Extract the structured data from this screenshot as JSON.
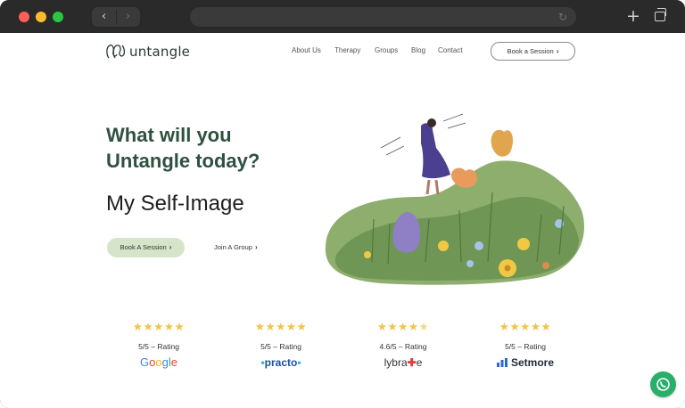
{
  "browser": {
    "back_icon": "chevron-left",
    "forward_icon": "chevron-right",
    "reload_icon": "reload",
    "new_tab_icon": "plus",
    "tabs_icon": "tabs-overview",
    "colors": {
      "chrome": "#2a2a2a",
      "close": "#ff5f57",
      "minimize": "#febc2e",
      "zoom": "#28c840"
    }
  },
  "header": {
    "logo_text": "untangle",
    "nav": [
      "About Us",
      "Therapy",
      "Groups",
      "Blog",
      "Contact"
    ],
    "book_label": "Book a Session"
  },
  "hero": {
    "headline_line1": "What will you",
    "headline_line2": "Untangle today?",
    "subhead": "My Self-Image",
    "cta_primary": "Book A Session",
    "cta_secondary": "Join A Group",
    "colors": {
      "headline": "#2e5140",
      "cta_bg": "#d6e5c9"
    }
  },
  "ratings": [
    {
      "stars": 5,
      "text": "5/5 – Rating",
      "brand": "Google"
    },
    {
      "stars": 5,
      "text": "5/5 – Rating",
      "brand": "practo"
    },
    {
      "stars": 4.5,
      "text": "4.6/5 – Rating",
      "brand": "lybrate"
    },
    {
      "stars": 5,
      "text": "5/5 – Rating",
      "brand": "Setmore"
    }
  ],
  "whatsapp_icon": "whatsapp"
}
